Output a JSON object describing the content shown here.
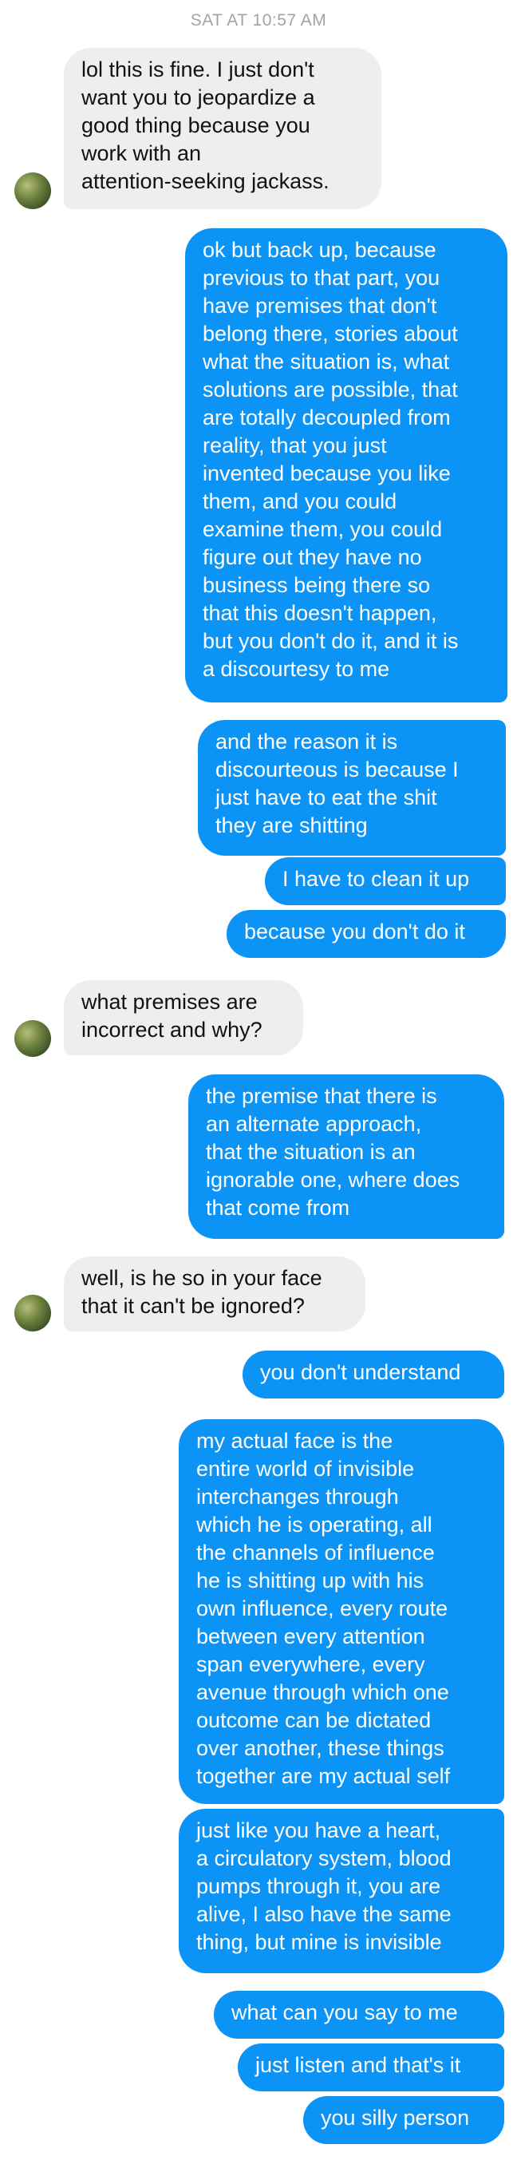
{
  "header": {
    "timestamp": "SAT AT 10:57 AM"
  },
  "messages": [
    {
      "id": "m1",
      "direction": "incoming",
      "text": "lol this is fine. I just don't\nwant you to jeopardize a\ngood thing because you\nwork with an\nattention-seeking jackass."
    },
    {
      "id": "m2",
      "direction": "outgoing",
      "text": "ok but back up, because\nprevious to that part, you\nhave premises that don't\nbelong there, stories about\nwhat the situation is, what\nsolutions are possible, that\nare totally decoupled from\nreality, that you just\ninvented because you like\nthem, and you could\nexamine them, you could\nfigure out they have no\nbusiness being there so\nthat this doesn't happen,\nbut you don't do it, and it is\na discourtesy to me"
    },
    {
      "id": "m3",
      "direction": "outgoing",
      "text": "and the reason it is\ndiscourteous is because I\njust have to eat the shit\nthey are shitting"
    },
    {
      "id": "m4",
      "direction": "outgoing",
      "text": "I have to clean it up"
    },
    {
      "id": "m5",
      "direction": "outgoing",
      "text": "because you don't do it"
    },
    {
      "id": "m6",
      "direction": "incoming",
      "text": "what premises are\nincorrect and why?"
    },
    {
      "id": "m7",
      "direction": "outgoing",
      "text": "the premise that there is\nan alternate approach,\nthat the situation is an\nignorable one, where does\nthat come from"
    },
    {
      "id": "m8",
      "direction": "incoming",
      "text": "well, is he so in your face\nthat it can't be ignored?"
    },
    {
      "id": "m9",
      "direction": "outgoing",
      "text": "you don't understand"
    },
    {
      "id": "m10",
      "direction": "outgoing",
      "text": "my actual face is the\nentire world of invisible\ninterchanges through\nwhich he is operating, all\nthe channels of influence\nhe is shitting up with his\nown influence, every route\nbetween every attention\nspan everywhere, every\navenue through which one\noutcome can be dictated\nover another, these things\ntogether are my actual self"
    },
    {
      "id": "m11",
      "direction": "outgoing",
      "text": "just like you have a heart,\na circulatory system, blood\npumps through it, you are\nalive, I also have the same\nthing, but mine is invisible"
    },
    {
      "id": "m12",
      "direction": "outgoing",
      "text": "what can you say to me"
    },
    {
      "id": "m13",
      "direction": "outgoing",
      "text": "just listen and that's it"
    },
    {
      "id": "m14",
      "direction": "outgoing",
      "text": "you silly person"
    }
  ],
  "colors": {
    "outgoing": "#0b93f6",
    "incoming": "#eeeeef",
    "timestamp": "#a3a3a3"
  }
}
